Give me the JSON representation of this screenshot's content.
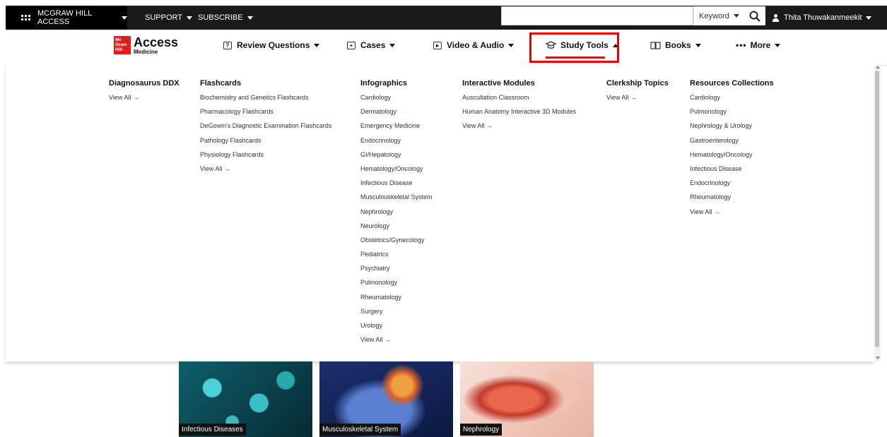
{
  "topbar": {
    "brand_menu": "MCGRAW HILL ACCESS",
    "support": "SUPPORT",
    "subscribe": "SUBSCRIBE",
    "search_value": "",
    "search_type": "Keyword",
    "user_name": "Thita Thuwakanmeekit"
  },
  "logo": {
    "box_text": "Mc Graw Hill",
    "title": "Access",
    "subtitle": "Medicine"
  },
  "nav": {
    "items": [
      {
        "label": "Review Questions"
      },
      {
        "label": "Cases"
      },
      {
        "label": "Video & Audio"
      },
      {
        "label": "Study Tools"
      },
      {
        "label": "Books"
      },
      {
        "label": "More"
      }
    ],
    "active": "Study Tools",
    "active_color": "#c41c1c",
    "highlight_color": "#e00000"
  },
  "mega_menu": {
    "columns": [
      {
        "title": "Diagnosaurus DDX",
        "items": [],
        "view_all": "View All"
      },
      {
        "title": "Flashcards",
        "items": [
          "Biochemistry and Genetics Flashcards",
          "Pharmacology Flashcards",
          "DeGowin's Diagnostic Examination Flashcards",
          "Pathology Flashcards",
          "Physiology Flashcards"
        ],
        "view_all": "View All"
      },
      {
        "title": "Infographics",
        "items": [
          "Cardiology",
          "Dermatology",
          "Emergency Medicine",
          "Endocrinology",
          "GI/Hepatology",
          "Hematology/Oncology",
          "Infectious Disease",
          "Musculouskeletal System",
          "Nephrology",
          "Neurology",
          "Obstetrics/Gynecology",
          "Pediatrics",
          "Psychiatry",
          "Pulmonology",
          "Rheumatology",
          "Surgery",
          "Urology"
        ],
        "view_all": "View All"
      },
      {
        "title": "Interactive Modules",
        "items": [
          "Auscultation Classroom",
          "Human Anatomy Interactive 3D Modules"
        ],
        "view_all": "View All"
      },
      {
        "title": "Clerkship Topics",
        "items": [],
        "view_all": "View All"
      },
      {
        "title": "Resources Collections",
        "items": [
          "Cardiology",
          "Pulmonology",
          "Nephrology & Urology",
          "Gastroenterology",
          "Hematology/Oncology",
          "Infectious Disease",
          "Endocrinology",
          "Rheumatology"
        ],
        "view_all": "View All"
      }
    ]
  },
  "cards": [
    {
      "caption": "Infectious Diseases"
    },
    {
      "caption": "Musculoskeletal System"
    },
    {
      "caption": "Nephrology"
    }
  ]
}
